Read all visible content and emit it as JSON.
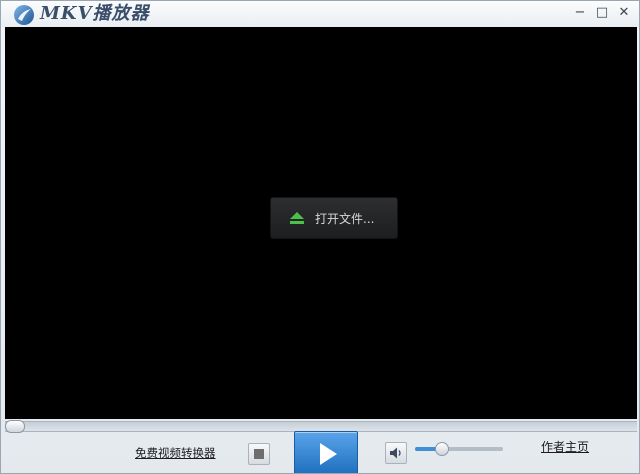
{
  "window": {
    "title": "MKV播放器",
    "controls": {
      "minimize_label": "−",
      "maximize_label": "□",
      "close_label": "✕"
    }
  },
  "video": {
    "open_file_label": "打开文件...",
    "open_file_icon": "eject-icon"
  },
  "playback": {
    "progress_fraction": 0,
    "volume_fraction": 0.3
  },
  "toolbar": {
    "converter_link": "免费视频转换器",
    "stop_icon": "stop-icon",
    "play_icon": "play-icon",
    "volume_icon": "speaker-icon",
    "author_link": "作者主页"
  },
  "colors": {
    "accent": "#2f86d8",
    "eject_green": "#4cc04a",
    "video_background": "#000000"
  }
}
